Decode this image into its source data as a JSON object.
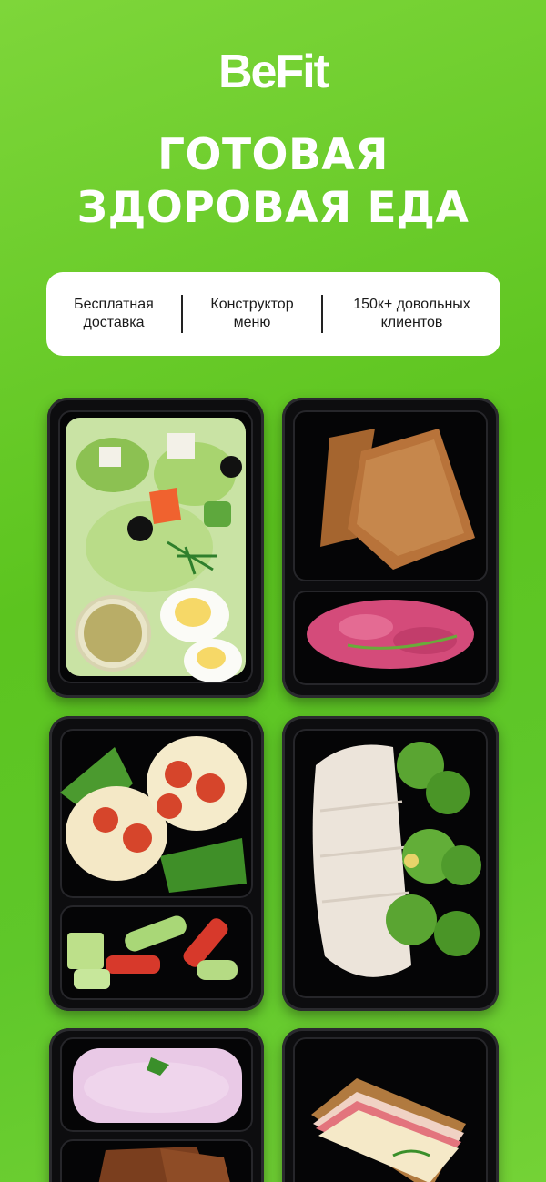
{
  "brand": {
    "logo_text": "BeFit"
  },
  "headline": {
    "line1": "ГОТОВАЯ",
    "line2": "ЗДОРОВАЯ ЕДА"
  },
  "features": [
    {
      "line1": "Бесплатная",
      "line2": "доставка"
    },
    {
      "line1": "Конструктор",
      "line2": "меню"
    },
    {
      "line1": "150к+ довольных",
      "line2": "клиентов"
    }
  ],
  "colors": {
    "background": "#5cc41f",
    "card": "#ffffff",
    "tray": "#0d0d0f"
  },
  "meals": [
    {
      "name": "salad-with-eggs"
    },
    {
      "name": "bread-with-beet-spread"
    },
    {
      "name": "eggs-with-tomato-and-vegetables"
    },
    {
      "name": "chicken-with-broccoli"
    },
    {
      "name": "yogurt-dessert"
    },
    {
      "name": "sandwich"
    }
  ]
}
